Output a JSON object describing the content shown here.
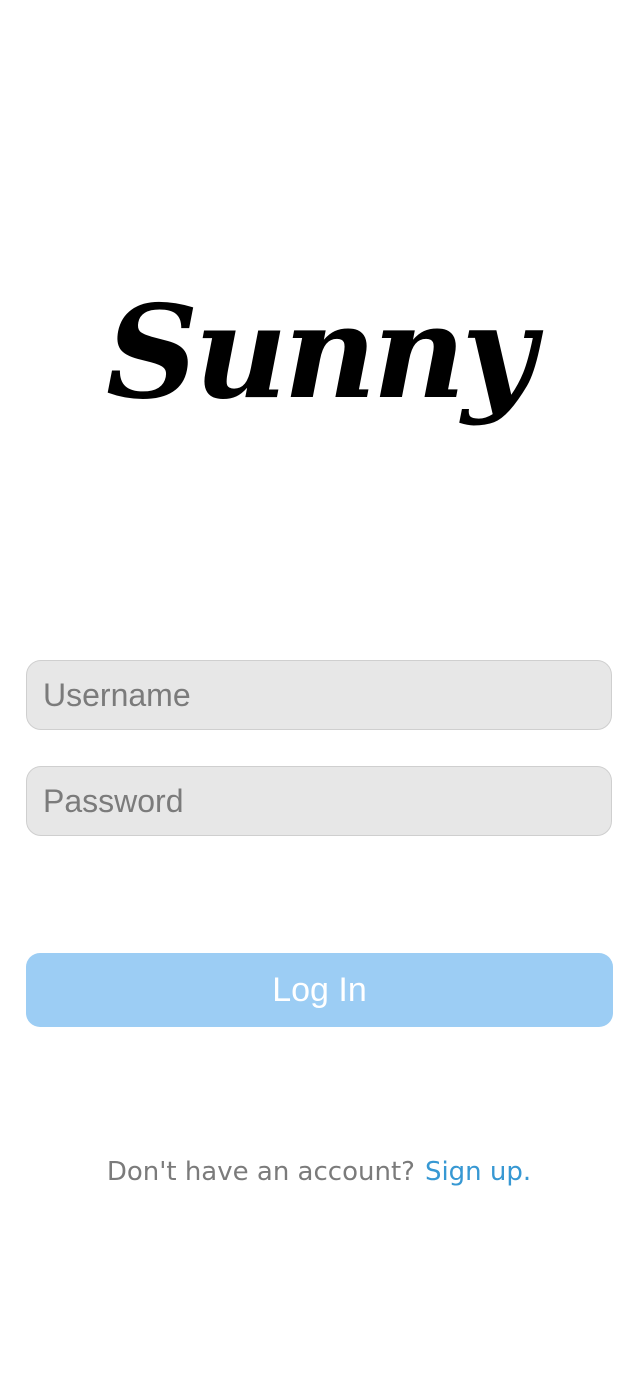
{
  "app": {
    "logo_text": "Sunny"
  },
  "login_form": {
    "username_placeholder": "Username",
    "password_placeholder": "Password",
    "submit_label": "Log In"
  },
  "signup": {
    "prompt": "Don't have an account?",
    "link_label": "Sign up."
  },
  "colors": {
    "button_background": "#9ccdf4",
    "button_text": "#ffffff",
    "input_background": "#e7e7e7",
    "input_border": "#cfcfcf",
    "placeholder_text": "#7b7b7b",
    "link": "#3798d3"
  }
}
